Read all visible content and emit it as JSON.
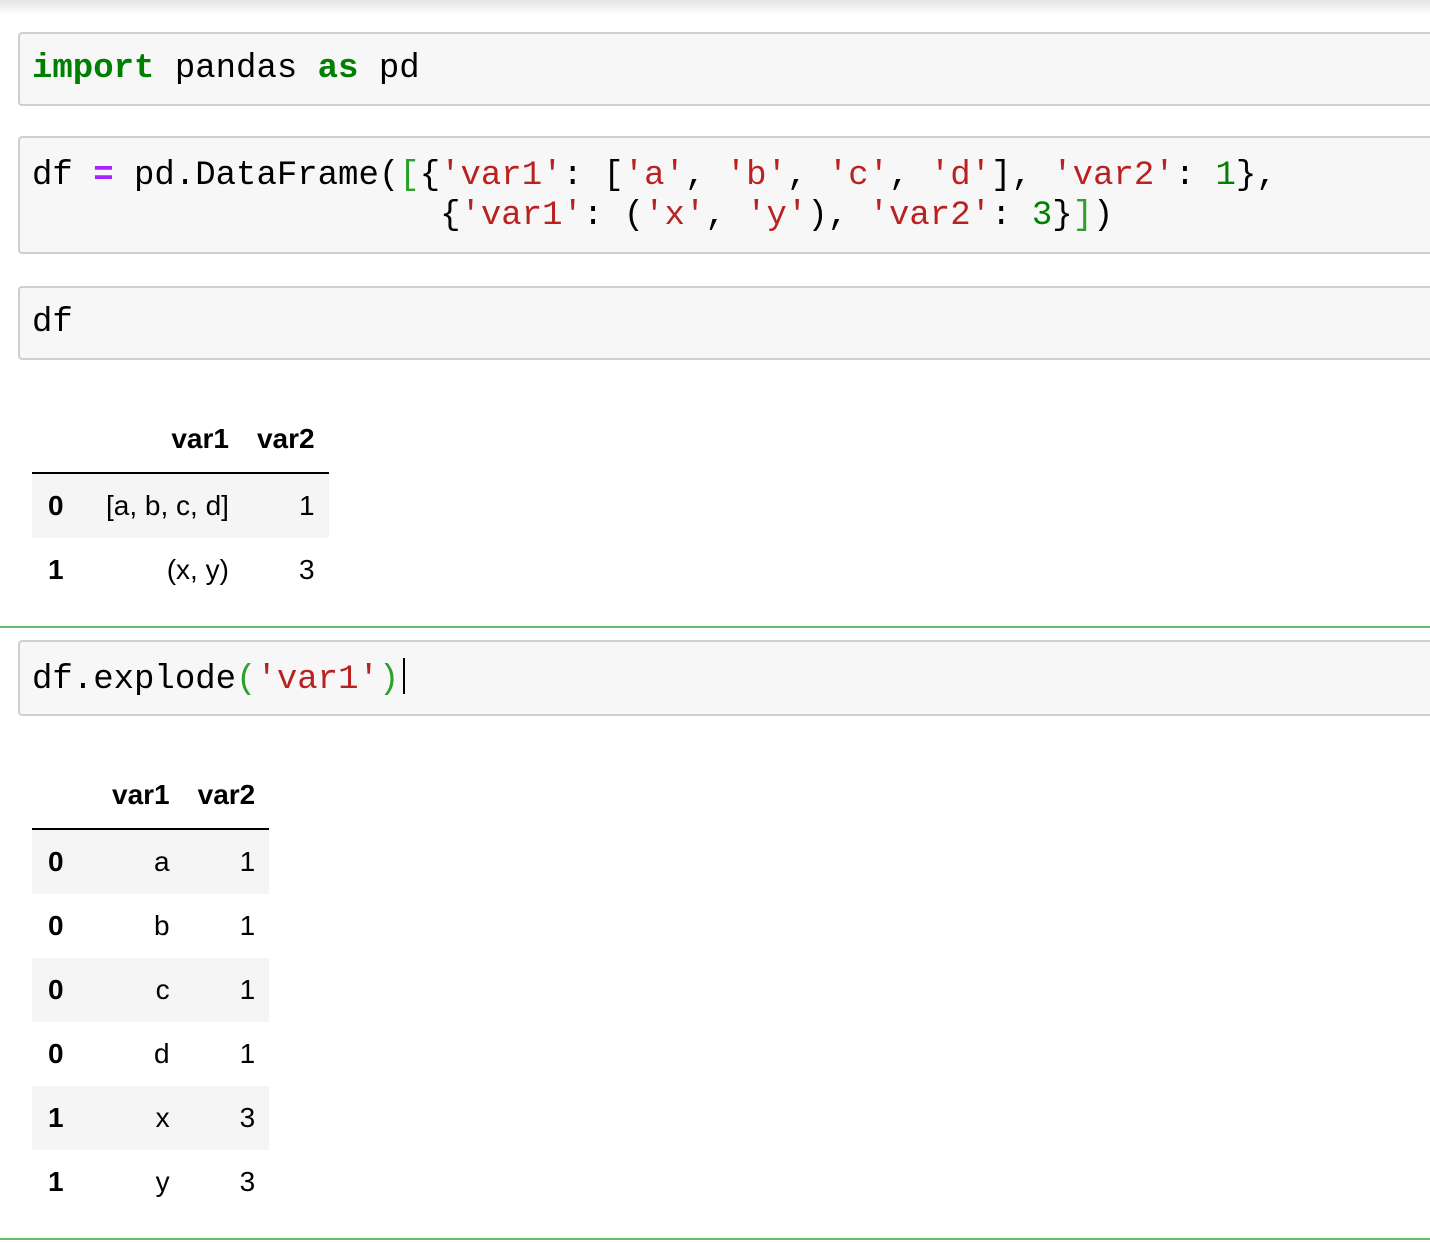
{
  "cells": [
    {
      "code_tokens": [
        "import",
        " pandas ",
        "as",
        " pd"
      ]
    },
    {
      "line1": [
        "df ",
        "=",
        " pd.DataFrame(",
        "[",
        "{",
        "'var1'",
        ": [",
        "'a'",
        ", ",
        "'b'",
        ", ",
        "'c'",
        ", ",
        "'d'",
        "], ",
        "'var2'",
        ": ",
        "1",
        "},"
      ],
      "line2": [
        "                    {",
        "'var1'",
        ": (",
        "'x'",
        ", ",
        "'y'",
        "), ",
        "'var2'",
        ": ",
        "3",
        "}",
        "]",
        ")"
      ]
    },
    {
      "code": "df"
    },
    {
      "code_tokens": [
        "df.explode",
        "(",
        "'var1'",
        ")"
      ]
    }
  ],
  "output1": {
    "columns": [
      "",
      "var1",
      "var2"
    ],
    "rows": [
      {
        "index": "0",
        "var1": "[a, b, c, d]",
        "var2": "1"
      },
      {
        "index": "1",
        "var1": "(x, y)",
        "var2": "3"
      }
    ]
  },
  "output2": {
    "columns": [
      "",
      "var1",
      "var2"
    ],
    "rows": [
      {
        "index": "0",
        "var1": "a",
        "var2": "1"
      },
      {
        "index": "0",
        "var1": "b",
        "var2": "1"
      },
      {
        "index": "0",
        "var1": "c",
        "var2": "1"
      },
      {
        "index": "0",
        "var1": "d",
        "var2": "1"
      },
      {
        "index": "1",
        "var1": "x",
        "var2": "3"
      },
      {
        "index": "1",
        "var1": "y",
        "var2": "3"
      }
    ]
  },
  "colors": {
    "keyword": "#008000",
    "operator": "#aa22ff",
    "string": "#ba2121",
    "number": "#008000",
    "bracket": "#2ca02c",
    "selected_cell": "#66bb6a"
  }
}
